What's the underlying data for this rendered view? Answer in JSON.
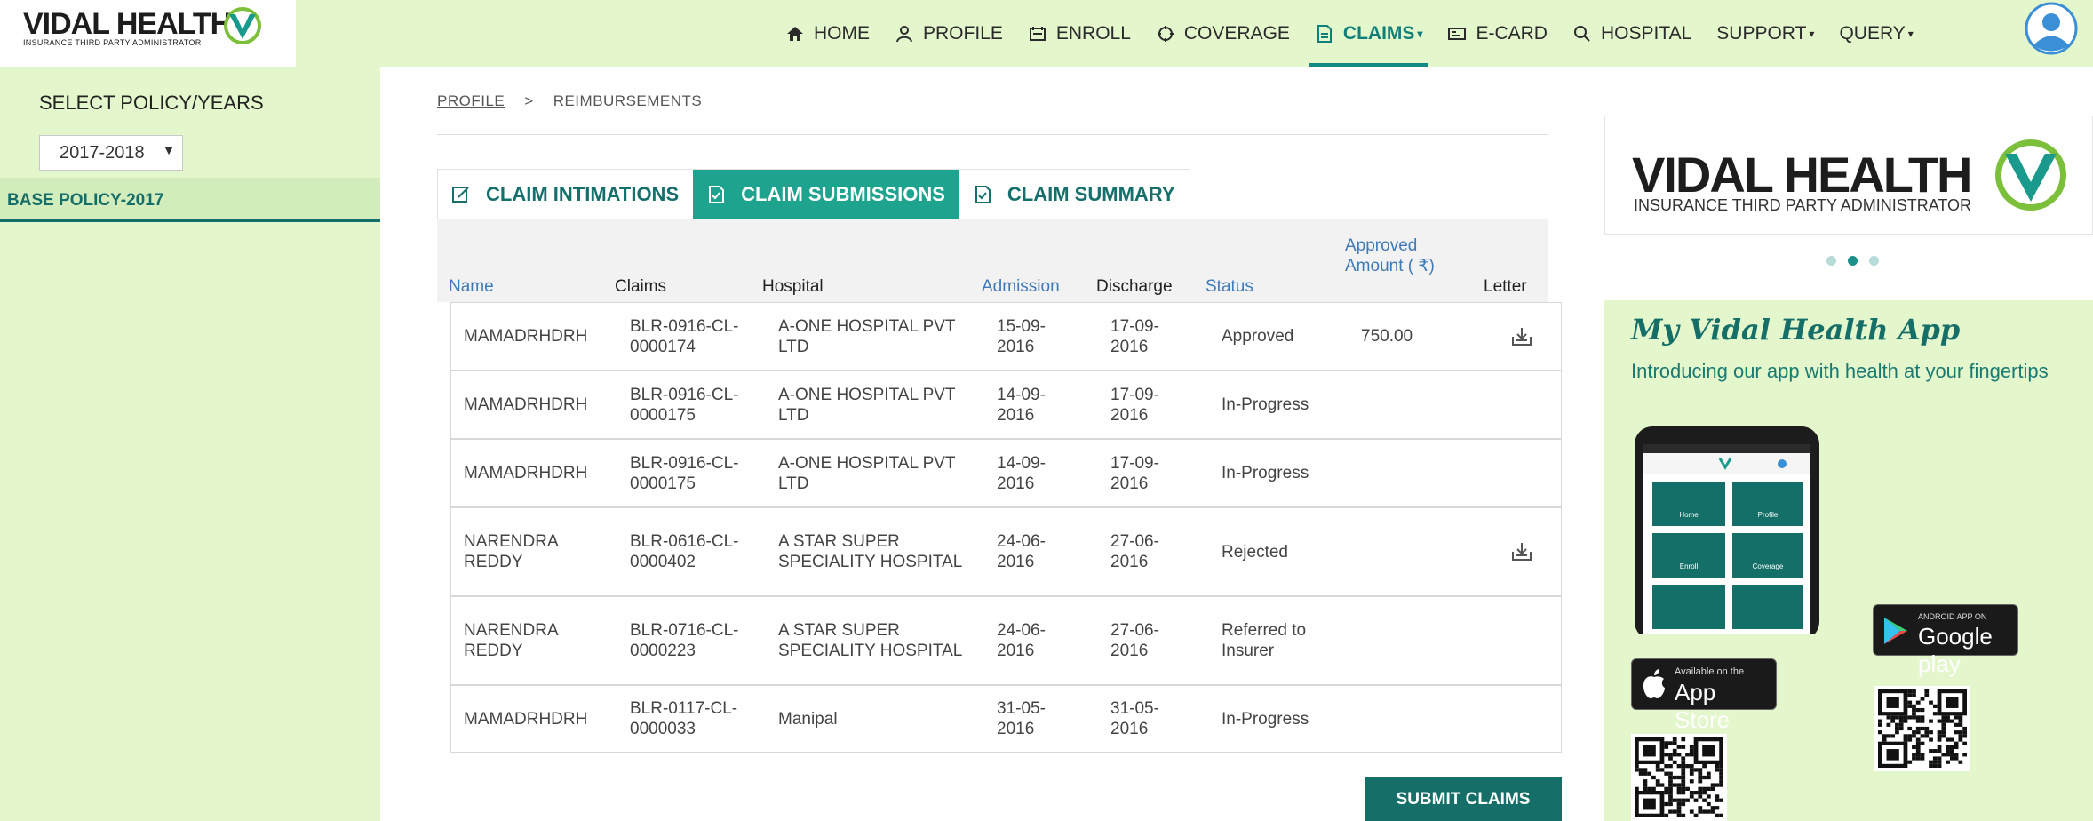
{
  "header": {
    "logo": "VIDAL HEALTH",
    "logo_sub": "INSURANCE THIRD PARTY ADMINISTRATOR",
    "nav": [
      {
        "label": "HOME",
        "icon": "home-icon"
      },
      {
        "label": "PROFILE",
        "icon": "user-icon"
      },
      {
        "label": "ENROLL",
        "icon": "enroll-icon"
      },
      {
        "label": "COVERAGE",
        "icon": "coverage-icon"
      },
      {
        "label": "CLAIMS",
        "icon": "claims-icon",
        "active": true,
        "dropdown": true
      },
      {
        "label": "E-CARD",
        "icon": "ecard-icon"
      },
      {
        "label": "HOSPITAL",
        "icon": "search-icon"
      },
      {
        "label": "SUPPORT",
        "dropdown": true
      },
      {
        "label": "QUERY",
        "dropdown": true
      }
    ]
  },
  "sidebar": {
    "title": "SELECT POLICY/YEARS",
    "year_value": "2017-2018",
    "policy": "BASE POLICY-2017"
  },
  "breadcrumb": {
    "profile": "PROFILE",
    "separator": ">",
    "current": "REIMBURSEMENTS"
  },
  "tabs": [
    {
      "label": "CLAIM INTIMATIONS",
      "active": false
    },
    {
      "label": "CLAIM SUBMISSIONS",
      "active": true
    },
    {
      "label": "CLAIM SUMMARY",
      "active": false
    }
  ],
  "table": {
    "headers": {
      "name": "Name",
      "claims": "Claims",
      "hospital": "Hospital",
      "admission": "Admission",
      "discharge": "Discharge",
      "status": "Status",
      "amount": "Approved Amount ( ₹)",
      "letter": "Letter"
    },
    "rows": [
      {
        "name": "MAMADRHDRH",
        "claim": "BLR-0916-CL-0000174",
        "hospital": "A-ONE HOSPITAL PVT LTD",
        "admission": "15-09-2016",
        "discharge": "17-09-2016",
        "status": "Approved",
        "amount": "750.00",
        "letter": true
      },
      {
        "name": "MAMADRHDRH",
        "claim": "BLR-0916-CL-0000175",
        "hospital": "A-ONE HOSPITAL PVT LTD",
        "admission": "14-09-2016",
        "discharge": "17-09-2016",
        "status": "In-Progress",
        "amount": "",
        "letter": false
      },
      {
        "name": "MAMADRHDRH",
        "claim": "BLR-0916-CL-0000175",
        "hospital": "A-ONE HOSPITAL PVT LTD",
        "admission": "14-09-2016",
        "discharge": "17-09-2016",
        "status": "In-Progress",
        "amount": "",
        "letter": false
      },
      {
        "name": "NARENDRA REDDY",
        "claim": "BLR-0616-CL-0000402",
        "hospital": "A STAR SUPER SPECIALITY HOSPITAL",
        "admission": "24-06-2016",
        "discharge": "27-06-2016",
        "status": "Rejected",
        "amount": "",
        "letter": true
      },
      {
        "name": "NARENDRA REDDY",
        "claim": "BLR-0716-CL-0000223",
        "hospital": "A STAR SUPER SPECIALITY HOSPITAL",
        "admission": "24-06-2016",
        "discharge": "27-06-2016",
        "status": "Referred to Insurer",
        "amount": "",
        "letter": false
      },
      {
        "name": "MAMADRHDRH",
        "claim": "BLR-0117-CL-0000033",
        "hospital": "Manipal",
        "admission": "31-05-2016",
        "discharge": "31-05-2016",
        "status": "In-Progress",
        "amount": "",
        "letter": false
      }
    ]
  },
  "submit_label": "SUBMIT CLAIMS",
  "promo": {
    "logo": "VIDAL HEALTH",
    "logo_sub": "INSURANCE THIRD PARTY ADMINISTRATOR",
    "app_title": "My Vidal Health App",
    "app_sub": "Introducing our app with health at your fingertips",
    "phone_tiles": [
      "Home",
      "Profile",
      "Enroll",
      "Coverage"
    ],
    "google_small": "ANDROID APP ON",
    "google_big": "Google play",
    "apple_small": "Available on the",
    "apple_big": "App Store"
  },
  "colors": {
    "header_bg": "#e3f6cc",
    "accent": "#156e68",
    "tab_active": "#1ea38f",
    "link_blue": "#3f7ab8"
  }
}
